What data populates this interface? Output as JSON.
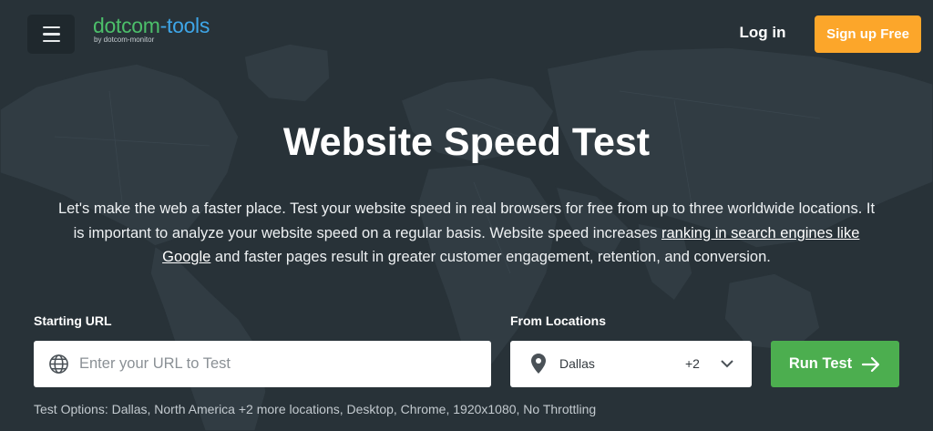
{
  "header": {
    "logo_primary_a": "dotcom",
    "logo_primary_b": "-tools",
    "logo_sub": "by dotcom-monitor",
    "login_label": "Log in",
    "signup_label": "Sign up Free"
  },
  "hero": {
    "title": "Website Speed Test",
    "desc_part1": "Let's make the web a faster place. Test your website speed in real browsers for free from up to three worldwide locations. It is important to analyze your website speed on a regular basis. Website speed increases ",
    "desc_link": "ranking in search engines like Google",
    "desc_part2": " and faster pages result in greater customer engagement, retention, and conversion."
  },
  "form": {
    "url_label": "Starting URL",
    "url_placeholder": "Enter your URL to Test",
    "url_value": "",
    "locations_label": "From Locations",
    "location_selected": "Dallas",
    "location_more": "+2",
    "run_label": "Run Test",
    "test_options": "Test Options: Dallas, North America +2 more locations, Desktop, Chrome, 1920x1080, No Throttling"
  },
  "icons": {
    "menu": "hamburger-icon",
    "url": "globe-icon",
    "location": "map-pin-icon",
    "dropdown": "chevron-down-icon",
    "run": "arrow-right-icon"
  },
  "colors": {
    "background": "#283238",
    "signup_accent": "#fca62a",
    "run_accent": "#4cae4f",
    "logo_green": "#4cbf6a",
    "logo_blue": "#3ea6e8"
  }
}
